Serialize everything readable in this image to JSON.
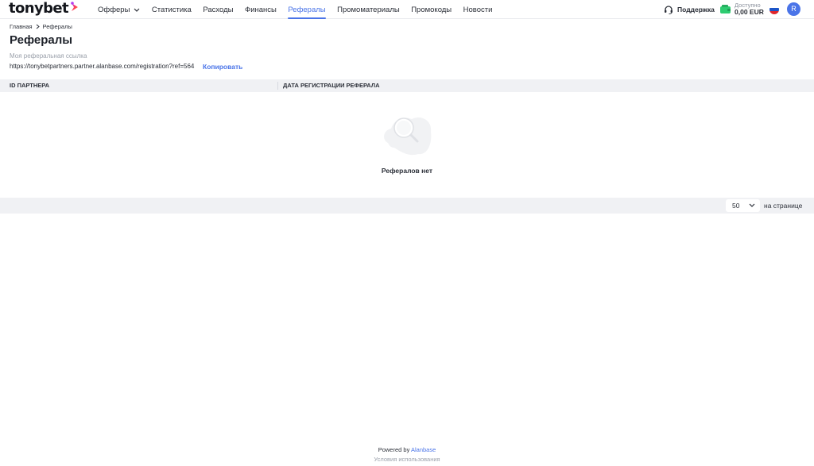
{
  "header": {
    "logo_text": "tonybet",
    "nav": [
      {
        "label": "Офферы",
        "has_dropdown": true,
        "active": false
      },
      {
        "label": "Статистика",
        "active": false
      },
      {
        "label": "Расходы",
        "active": false
      },
      {
        "label": "Финансы",
        "active": false
      },
      {
        "label": "Рефералы",
        "active": true
      },
      {
        "label": "Промоматериалы",
        "active": false
      },
      {
        "label": "Промокоды",
        "active": false
      },
      {
        "label": "Новости",
        "active": false
      }
    ],
    "support_label": "Поддержка",
    "balance_label": "Доступно",
    "balance_amount": "0,00 EUR",
    "avatar_initial": "R",
    "accent_color": "#4a74e8"
  },
  "breadcrumb": {
    "home": "Главная",
    "current": "Рефералы"
  },
  "page": {
    "title": "Рефералы",
    "ref_label": "Моя реферальная ссылка",
    "ref_link": "https://tonybetpartners.partner.alanbase.com/registration?ref=564",
    "copy_label": "Копировать"
  },
  "table": {
    "columns": [
      "ID ПАРТНЕРА",
      "ДАТА РЕГИСТРАЦИИ РЕФЕРАЛА"
    ],
    "rows": [],
    "empty_text": "Рефералов нет"
  },
  "pagination": {
    "per_page_value": "50",
    "per_page_label": "на странице"
  },
  "footer": {
    "powered_prefix": "Powered by",
    "powered_brand": "Alanbase",
    "terms": "Условия использования"
  }
}
